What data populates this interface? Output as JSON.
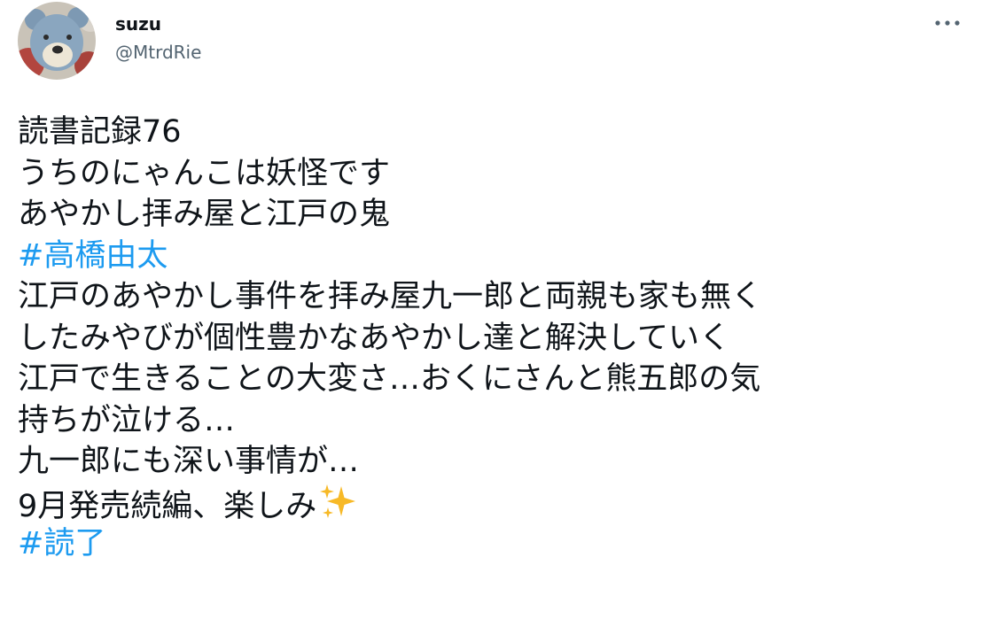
{
  "user": {
    "display_name": "suzu",
    "handle": "@MtrdRie",
    "avatar_icon": "knitted-bear-avatar-icon"
  },
  "more_icon": "more-dots-icon",
  "tweet": {
    "lines": [
      "読書記録76",
      "うちのにゃんこは妖怪です",
      "あやかし拝み屋と江戸の鬼"
    ],
    "hashtag_1": "#高橋由太",
    "body_lines": [
      "江戸のあやかし事件を拝み屋九一郎と両親も家も無く",
      "したみやびが個性豊かなあやかし達と解決していく",
      "江戸で生きることの大変さ…おくにさんと熊五郎の気",
      "持ちが泣ける…",
      "九一郎にも深い事情が…"
    ],
    "last_line_text": "9月発売続編、楽しみ",
    "sparkle_icon": "sparkles-emoji-icon",
    "hashtag_2": "#読了"
  },
  "colors": {
    "text": "#0f1419",
    "secondary": "#536471",
    "hashtag": "#1d9bf0",
    "sparkle": "#f7b927"
  }
}
